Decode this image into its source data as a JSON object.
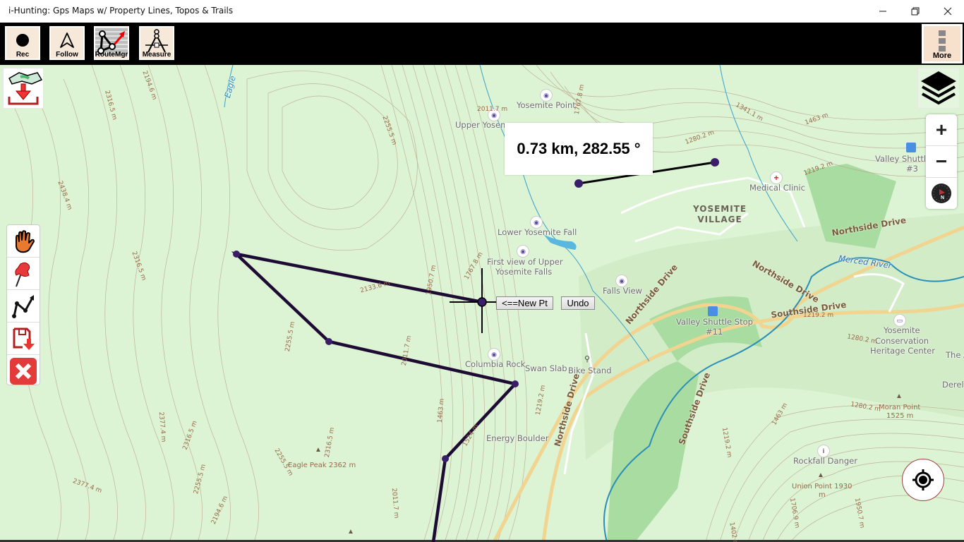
{
  "window": {
    "title": "i-Hunting: Gps Maps w/ Property Lines, Topos & Trails",
    "controls": [
      "minimize",
      "restore",
      "close"
    ]
  },
  "toolbar": {
    "buttons": [
      {
        "id": "rec",
        "label": "Rec",
        "icon": "record-dot-icon"
      },
      {
        "id": "follow",
        "label": "Follow",
        "icon": "navigation-arrow-icon"
      },
      {
        "id": "routemgr",
        "label": "RouteMgr",
        "icon": "route-manager-icon"
      },
      {
        "id": "measure",
        "label": "Measure",
        "icon": "compass-divider-icon"
      }
    ],
    "more_label": "More"
  },
  "map_controls": {
    "download_map": "download-map-icon",
    "layers": "layers-icon",
    "zoom_in": "+",
    "zoom_out": "−",
    "compass_letter": "N",
    "locate": "locate-crosshair-icon"
  },
  "side_tools": [
    {
      "id": "pan",
      "icon": "hand-icon"
    },
    {
      "id": "pin",
      "icon": "pushpin-icon"
    },
    {
      "id": "route",
      "icon": "route-line-icon"
    },
    {
      "id": "save",
      "icon": "save-download-icon"
    },
    {
      "id": "cancel",
      "icon": "close-x-icon"
    }
  ],
  "measurement": {
    "readout": "0.73 km, 282.55 °"
  },
  "route_editor": {
    "new_point_label": "<==New Pt",
    "undo_label": "Undo"
  },
  "map_labels": {
    "pois": [
      "Yosemite Point",
      "Upper Yosem",
      "Lower Yosemite Fall",
      "First view of Upper",
      "Yosemite Falls",
      "Falls View",
      "Columbia Rock",
      "Swan Slab",
      "Bike Stand",
      "Energy Boulder",
      "Medical Clinic",
      "Valley Shuttle",
      "#3",
      "Valley Shuttle Stop",
      "#11",
      "Yosemite",
      "Conservation",
      "Heritage Center",
      "The A",
      "Derel",
      "Rockfall Danger"
    ],
    "village": [
      "YOSEMITE",
      "VILLAGE"
    ],
    "roads": [
      "Northside Drive",
      "Northside Drive",
      "Northside Drive",
      "Northside Drive",
      "Southside Drive",
      "Southside Drive"
    ],
    "river": "Merced River",
    "creek": "Eagle",
    "peaks": [
      {
        "name": "Eagle Peak  2362 m"
      },
      {
        "name": "Moran Point",
        "elev": "1525 m"
      },
      {
        "name": "Union Point  1930",
        "elev": "m"
      }
    ],
    "elevations": [
      "2194.6 m",
      "2316.5 m",
      "2438.4 m",
      "2316.5 m",
      "2255.5 m",
      "2011.7 m",
      "1767.8 m",
      "2133.6 m",
      "1950.7 m",
      "2255.5 m",
      "2011.7 m",
      "1463 m",
      "1524 m",
      "2316.5 m",
      "2255.5 m",
      "2377.4 m",
      "2316.5 m",
      "2377.4 m",
      "2255.5 m",
      "2194.6 m",
      "2011.7 m",
      "1219.2 m",
      "1280.2 m",
      "1341.1 m",
      "1463 m",
      "1280.2 m",
      "1219.2 m",
      "1219.2 m",
      "1280.2 m",
      "1463 m",
      "1219.2 m",
      "1706.9 m",
      "1950.7 m",
      "1767.8 m",
      "1402 m"
    ]
  },
  "colors": {
    "map_bg": "#dcf3d4",
    "route_line": "#1e0b33",
    "route_node": "#3a1e6a",
    "toolbar_bg": "#000000",
    "button_bg": "#f7e9da",
    "road": "#f1d48f",
    "river": "#2a8fb8"
  }
}
